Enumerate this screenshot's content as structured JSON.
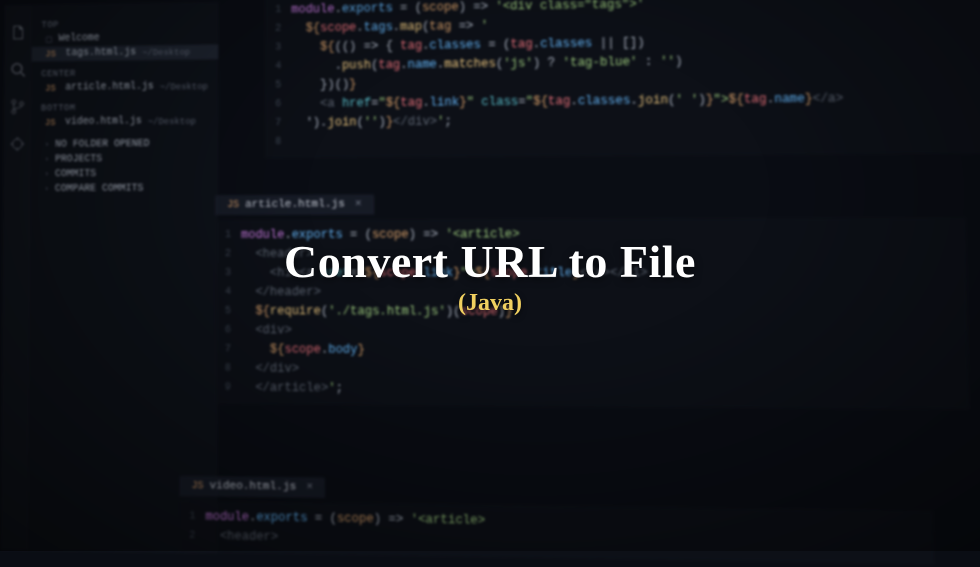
{
  "overlay": {
    "title": "Convert URL to File",
    "subtitle": "(Java)"
  },
  "sidebar": {
    "sections": {
      "top": "TOP",
      "center": "CENTER",
      "bottom": "BOTTOM"
    },
    "items": {
      "welcome": {
        "label": "Welcome"
      },
      "tags": {
        "ext": "JS",
        "label": "tags.html.js",
        "path": "~/Desktop"
      },
      "article": {
        "ext": "JS",
        "label": "article.html.js",
        "path": "~/Desktop"
      },
      "video": {
        "ext": "JS",
        "label": "video.html.js",
        "path": "~/Desktop"
      }
    },
    "footer": {
      "nofolder": "NO FOLDER OPENED",
      "projects": "PROJECTS",
      "commits": "COMMITS",
      "compare": "COMPARE COMMITS"
    }
  },
  "tabs": {
    "article": {
      "ext": "JS",
      "label": "article.html.js"
    },
    "video": {
      "ext": "JS",
      "label": "video.html.js"
    }
  },
  "pane1": {
    "lines": [
      {
        "n": "1",
        "segs": [
          [
            "c-purple",
            "module"
          ],
          [
            "c-white",
            "."
          ],
          [
            "c-blue",
            "exports"
          ],
          [
            "c-white",
            " = ("
          ],
          [
            "c-orange",
            "scope"
          ],
          [
            "c-white",
            ") => "
          ],
          [
            "c-green",
            "'<div class=\"tags\">'"
          ]
        ]
      },
      {
        "n": "2",
        "segs": [
          [
            "c-white",
            "  "
          ],
          [
            "c-orange",
            "${"
          ],
          [
            "c-red",
            "scope"
          ],
          [
            "c-white",
            "."
          ],
          [
            "c-blue",
            "tags"
          ],
          [
            "c-white",
            "."
          ],
          [
            "c-yellow",
            "map"
          ],
          [
            "c-white",
            "("
          ],
          [
            "c-orange",
            "tag"
          ],
          [
            "c-white",
            " => "
          ],
          [
            "c-green",
            "'"
          ]
        ]
      },
      {
        "n": "3",
        "segs": [
          [
            "c-white",
            "    "
          ],
          [
            "c-orange",
            "${"
          ],
          [
            "c-white",
            "(() => { "
          ],
          [
            "c-red",
            "tag"
          ],
          [
            "c-white",
            "."
          ],
          [
            "c-blue",
            "classes"
          ],
          [
            "c-white",
            " = ("
          ],
          [
            "c-red",
            "tag"
          ],
          [
            "c-white",
            "."
          ],
          [
            "c-blue",
            "classes"
          ],
          [
            "c-white",
            " || [])"
          ]
        ]
      },
      {
        "n": "4",
        "segs": [
          [
            "c-white",
            "      ."
          ],
          [
            "c-yellow",
            "push"
          ],
          [
            "c-white",
            "("
          ],
          [
            "c-red",
            "tag"
          ],
          [
            "c-white",
            "."
          ],
          [
            "c-blue",
            "name"
          ],
          [
            "c-white",
            "."
          ],
          [
            "c-yellow",
            "matches"
          ],
          [
            "c-white",
            "("
          ],
          [
            "c-green",
            "'js'"
          ],
          [
            "c-white",
            ") ? "
          ],
          [
            "c-green",
            "'tag-blue'"
          ],
          [
            "c-white",
            " : "
          ],
          [
            "c-green",
            "''"
          ],
          [
            "c-white",
            ")"
          ]
        ]
      },
      {
        "n": "5",
        "segs": [
          [
            "c-white",
            "    })()"
          ],
          [
            "c-orange",
            "}"
          ]
        ]
      },
      {
        "n": "6",
        "segs": [
          [
            "c-white",
            "    "
          ],
          [
            "c-gray",
            "<a "
          ],
          [
            "c-cyan",
            "href"
          ],
          [
            "c-white",
            "="
          ],
          [
            "c-green",
            "\""
          ],
          [
            "c-orange",
            "${"
          ],
          [
            "c-red",
            "tag"
          ],
          [
            "c-white",
            "."
          ],
          [
            "c-blue",
            "link"
          ],
          [
            "c-orange",
            "}"
          ],
          [
            "c-green",
            "\" "
          ],
          [
            "c-cyan",
            "class"
          ],
          [
            "c-white",
            "="
          ],
          [
            "c-green",
            "\""
          ],
          [
            "c-orange",
            "${"
          ],
          [
            "c-red",
            "tag"
          ],
          [
            "c-white",
            "."
          ],
          [
            "c-blue",
            "classes"
          ],
          [
            "c-white",
            "."
          ],
          [
            "c-yellow",
            "join"
          ],
          [
            "c-white",
            "("
          ],
          [
            "c-green",
            "' '"
          ],
          [
            "c-white",
            ")"
          ],
          [
            "c-orange",
            "}"
          ],
          [
            "c-green",
            "\">"
          ],
          [
            "c-orange",
            "${"
          ],
          [
            "c-red",
            "tag"
          ],
          [
            "c-white",
            "."
          ],
          [
            "c-blue",
            "name"
          ],
          [
            "c-orange",
            "}"
          ],
          [
            "c-gray",
            "</a>"
          ]
        ]
      },
      {
        "n": "7",
        "segs": [
          [
            "c-white",
            "  ')."
          ],
          [
            "c-yellow",
            "join"
          ],
          [
            "c-white",
            "("
          ],
          [
            "c-green",
            "''"
          ],
          [
            "c-white",
            ")"
          ],
          [
            "c-orange",
            "}"
          ],
          [
            "c-gray",
            "</div>"
          ],
          [
            "c-green",
            "'"
          ],
          [
            "c-white",
            ";"
          ]
        ]
      },
      {
        "n": "8",
        "segs": [
          [
            "c-white",
            " "
          ]
        ]
      }
    ]
  },
  "pane2": {
    "lines": [
      {
        "n": "1",
        "segs": [
          [
            "c-purple",
            "module"
          ],
          [
            "c-white",
            "."
          ],
          [
            "c-blue",
            "exports"
          ],
          [
            "c-white",
            " = ("
          ],
          [
            "c-orange",
            "scope"
          ],
          [
            "c-white",
            ") => "
          ],
          [
            "c-green",
            "'<article>"
          ]
        ]
      },
      {
        "n": "2",
        "segs": [
          [
            "c-white",
            "  "
          ],
          [
            "c-gray",
            "<header>"
          ]
        ]
      },
      {
        "n": "3",
        "segs": [
          [
            "c-white",
            "    "
          ],
          [
            "c-gray",
            "<h1><a "
          ],
          [
            "c-cyan",
            "href"
          ],
          [
            "c-white",
            "="
          ],
          [
            "c-green",
            "\""
          ],
          [
            "c-orange",
            "${"
          ],
          [
            "c-red",
            "scope"
          ],
          [
            "c-white",
            "."
          ],
          [
            "c-blue",
            "link"
          ],
          [
            "c-orange",
            "}"
          ],
          [
            "c-green",
            "\">"
          ],
          [
            "c-orange",
            "${"
          ],
          [
            "c-red",
            "scope"
          ],
          [
            "c-white",
            "."
          ],
          [
            "c-blue",
            "title"
          ],
          [
            "c-orange",
            "}"
          ],
          [
            "c-gray",
            "</a></h1>"
          ]
        ]
      },
      {
        "n": "4",
        "segs": [
          [
            "c-white",
            "  "
          ],
          [
            "c-gray",
            "</header>"
          ]
        ]
      },
      {
        "n": "5",
        "segs": [
          [
            "c-white",
            "  "
          ],
          [
            "c-orange",
            "${"
          ],
          [
            "c-yellow",
            "require"
          ],
          [
            "c-white",
            "("
          ],
          [
            "c-green",
            "'./tags.html.js'"
          ],
          [
            "c-white",
            ")("
          ],
          [
            "c-red",
            "scope"
          ],
          [
            "c-white",
            ")"
          ],
          [
            "c-orange",
            "}"
          ]
        ]
      },
      {
        "n": "6",
        "segs": [
          [
            "c-white",
            "  "
          ],
          [
            "c-gray",
            "<div>"
          ]
        ]
      },
      {
        "n": "7",
        "segs": [
          [
            "c-white",
            "    "
          ],
          [
            "c-orange",
            "${"
          ],
          [
            "c-red",
            "scope"
          ],
          [
            "c-white",
            "."
          ],
          [
            "c-blue",
            "body"
          ],
          [
            "c-orange",
            "}"
          ]
        ]
      },
      {
        "n": "8",
        "segs": [
          [
            "c-white",
            "  "
          ],
          [
            "c-gray",
            "</div>"
          ]
        ]
      },
      {
        "n": "9",
        "segs": [
          [
            "c-white",
            "  "
          ],
          [
            "c-gray",
            "</article>"
          ],
          [
            "c-green",
            "'"
          ],
          [
            "c-white",
            ";"
          ]
        ]
      }
    ]
  },
  "pane3": {
    "lines": [
      {
        "n": "1",
        "segs": [
          [
            "c-purple",
            "module"
          ],
          [
            "c-white",
            "."
          ],
          [
            "c-blue",
            "exports"
          ],
          [
            "c-white",
            " = ("
          ],
          [
            "c-orange",
            "scope"
          ],
          [
            "c-white",
            ") => "
          ],
          [
            "c-green",
            "'<article>"
          ]
        ]
      },
      {
        "n": "2",
        "segs": [
          [
            "c-white",
            "  "
          ],
          [
            "c-gray",
            "<header>"
          ]
        ]
      }
    ]
  }
}
